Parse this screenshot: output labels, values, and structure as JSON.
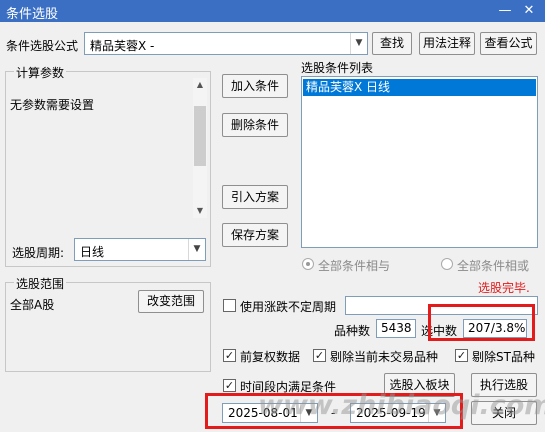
{
  "window": {
    "title": "条件选股",
    "minimize": "—",
    "close": "✕"
  },
  "formula": {
    "label": "条件选股公式",
    "value": "精品芙蓉X  -",
    "find": "查找",
    "usage": "用法注释",
    "view": "查看公式"
  },
  "params": {
    "legend": "计算参数",
    "none_text": "无参数需要设置",
    "period_label": "选股周期:",
    "period_value": "日线"
  },
  "condition_buttons": {
    "add": "加入条件",
    "delete": "删除条件",
    "import": "引入方案",
    "save": "保存方案"
  },
  "list": {
    "label": "选股条件列表",
    "items": [
      "精品芙蓉X  日线"
    ]
  },
  "logic": {
    "and_label": "全部条件相与",
    "or_label": "全部条件相或"
  },
  "status": {
    "text": "选股完毕.",
    "color": "#e31b1b"
  },
  "range": {
    "legend": "选股范围",
    "value": "全部A股",
    "change": "改变范围"
  },
  "uncertain_period": {
    "label": "使用涨跌不定周期",
    "checked": false
  },
  "stats": {
    "count_label": "品种数",
    "count_value": "5438",
    "selected_label": "选中数",
    "selected_value": "207/3.8%"
  },
  "options": [
    {
      "label": "前复权数据",
      "checked": true
    },
    {
      "label": "剔除当前未交易品种",
      "checked": true
    },
    {
      "label": "剔除ST品种",
      "checked": true
    }
  ],
  "time_range": {
    "label": "时间段内满足条件",
    "checked": true,
    "start": "2025-08-01",
    "sep": "-",
    "end": "2025-09-19"
  },
  "actions": {
    "to_block": "选股入板块",
    "execute": "执行选股",
    "close": "关闭"
  },
  "watermark": "www.zhibiaoqi.com",
  "colors": {
    "titlebar": "#3a6fc4",
    "selection": "#0078d7",
    "highlight": "#e31b1b"
  }
}
